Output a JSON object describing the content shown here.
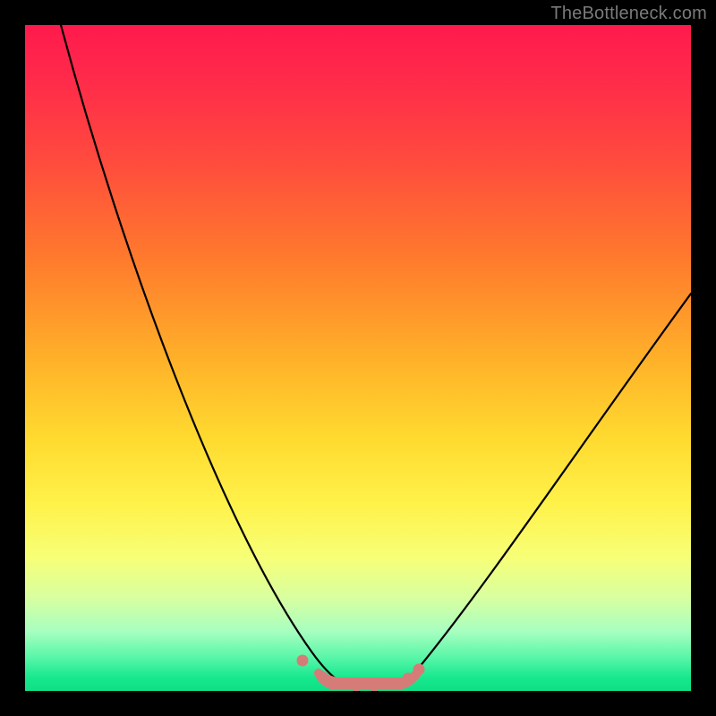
{
  "watermark": "TheBottleneck.com",
  "chart_data": {
    "type": "line",
    "title": "",
    "xlabel": "",
    "ylabel": "",
    "xlim": [
      0,
      100
    ],
    "ylim": [
      0,
      100
    ],
    "x": [
      0,
      5,
      10,
      15,
      20,
      25,
      30,
      35,
      40,
      42,
      45,
      48,
      50,
      52,
      55,
      58,
      60,
      65,
      70,
      75,
      80,
      85,
      90,
      95,
      100
    ],
    "values": [
      100,
      92,
      84,
      76,
      67,
      58,
      48,
      37,
      24,
      16,
      8,
      3,
      1,
      1,
      1,
      2,
      5,
      12,
      21,
      30,
      38,
      45,
      51,
      56,
      60
    ],
    "annotations": [
      {
        "type": "marker_run",
        "x_start": 42,
        "x_end": 58,
        "y": 2,
        "color": "#d67c78"
      }
    ],
    "colors": {
      "curve": "#000000",
      "background_top": "#ff1a4d",
      "background_bottom": "#0fdf86",
      "marker": "#d67c78"
    }
  }
}
